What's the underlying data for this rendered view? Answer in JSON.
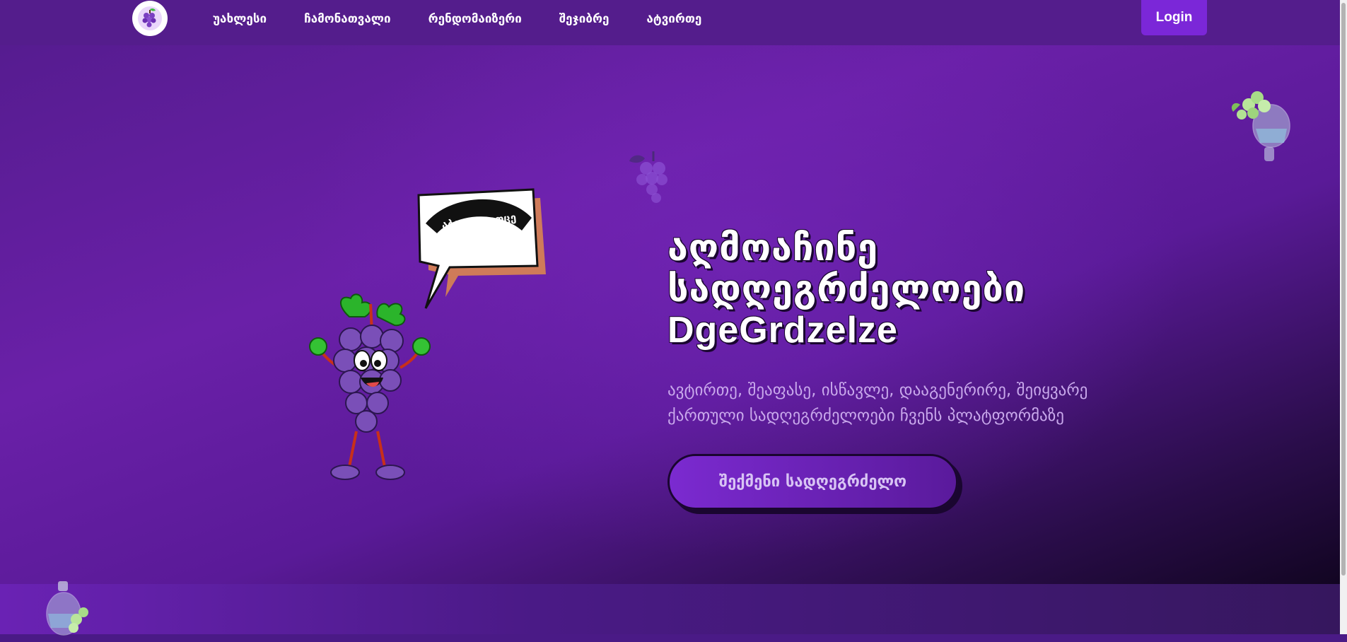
{
  "nav": {
    "logo_icon": "grape-logo-icon",
    "links": [
      {
        "label": "უახლესი"
      },
      {
        "label": "ჩამონათვალი"
      },
      {
        "label": "რენდომაიზერი"
      },
      {
        "label": "შეჯიბრე"
      },
      {
        "label": "ატვირთე"
      }
    ],
    "login_label": "Login"
  },
  "hero": {
    "title_line1": "აღმოაჩინე",
    "title_line2": "სადღეგრძელოები",
    "title_line3": "DgeGrdzelze",
    "subtitle": "ავტირთე, შეაფასე, ისწავლე, დააგენერირე, შეიყვარე ქართული სადღეგრძელოები ჩვენს პლატფორმაზე",
    "cta_label": "შექმენი სადღეგრძელო",
    "speech_bubble_text": "აბა დაილოცე"
  },
  "colors": {
    "nav_bg": "#541d8c",
    "accent": "#7b27d8",
    "title_text": "#ffffff",
    "subtitle_text": "#c9a9ec"
  }
}
